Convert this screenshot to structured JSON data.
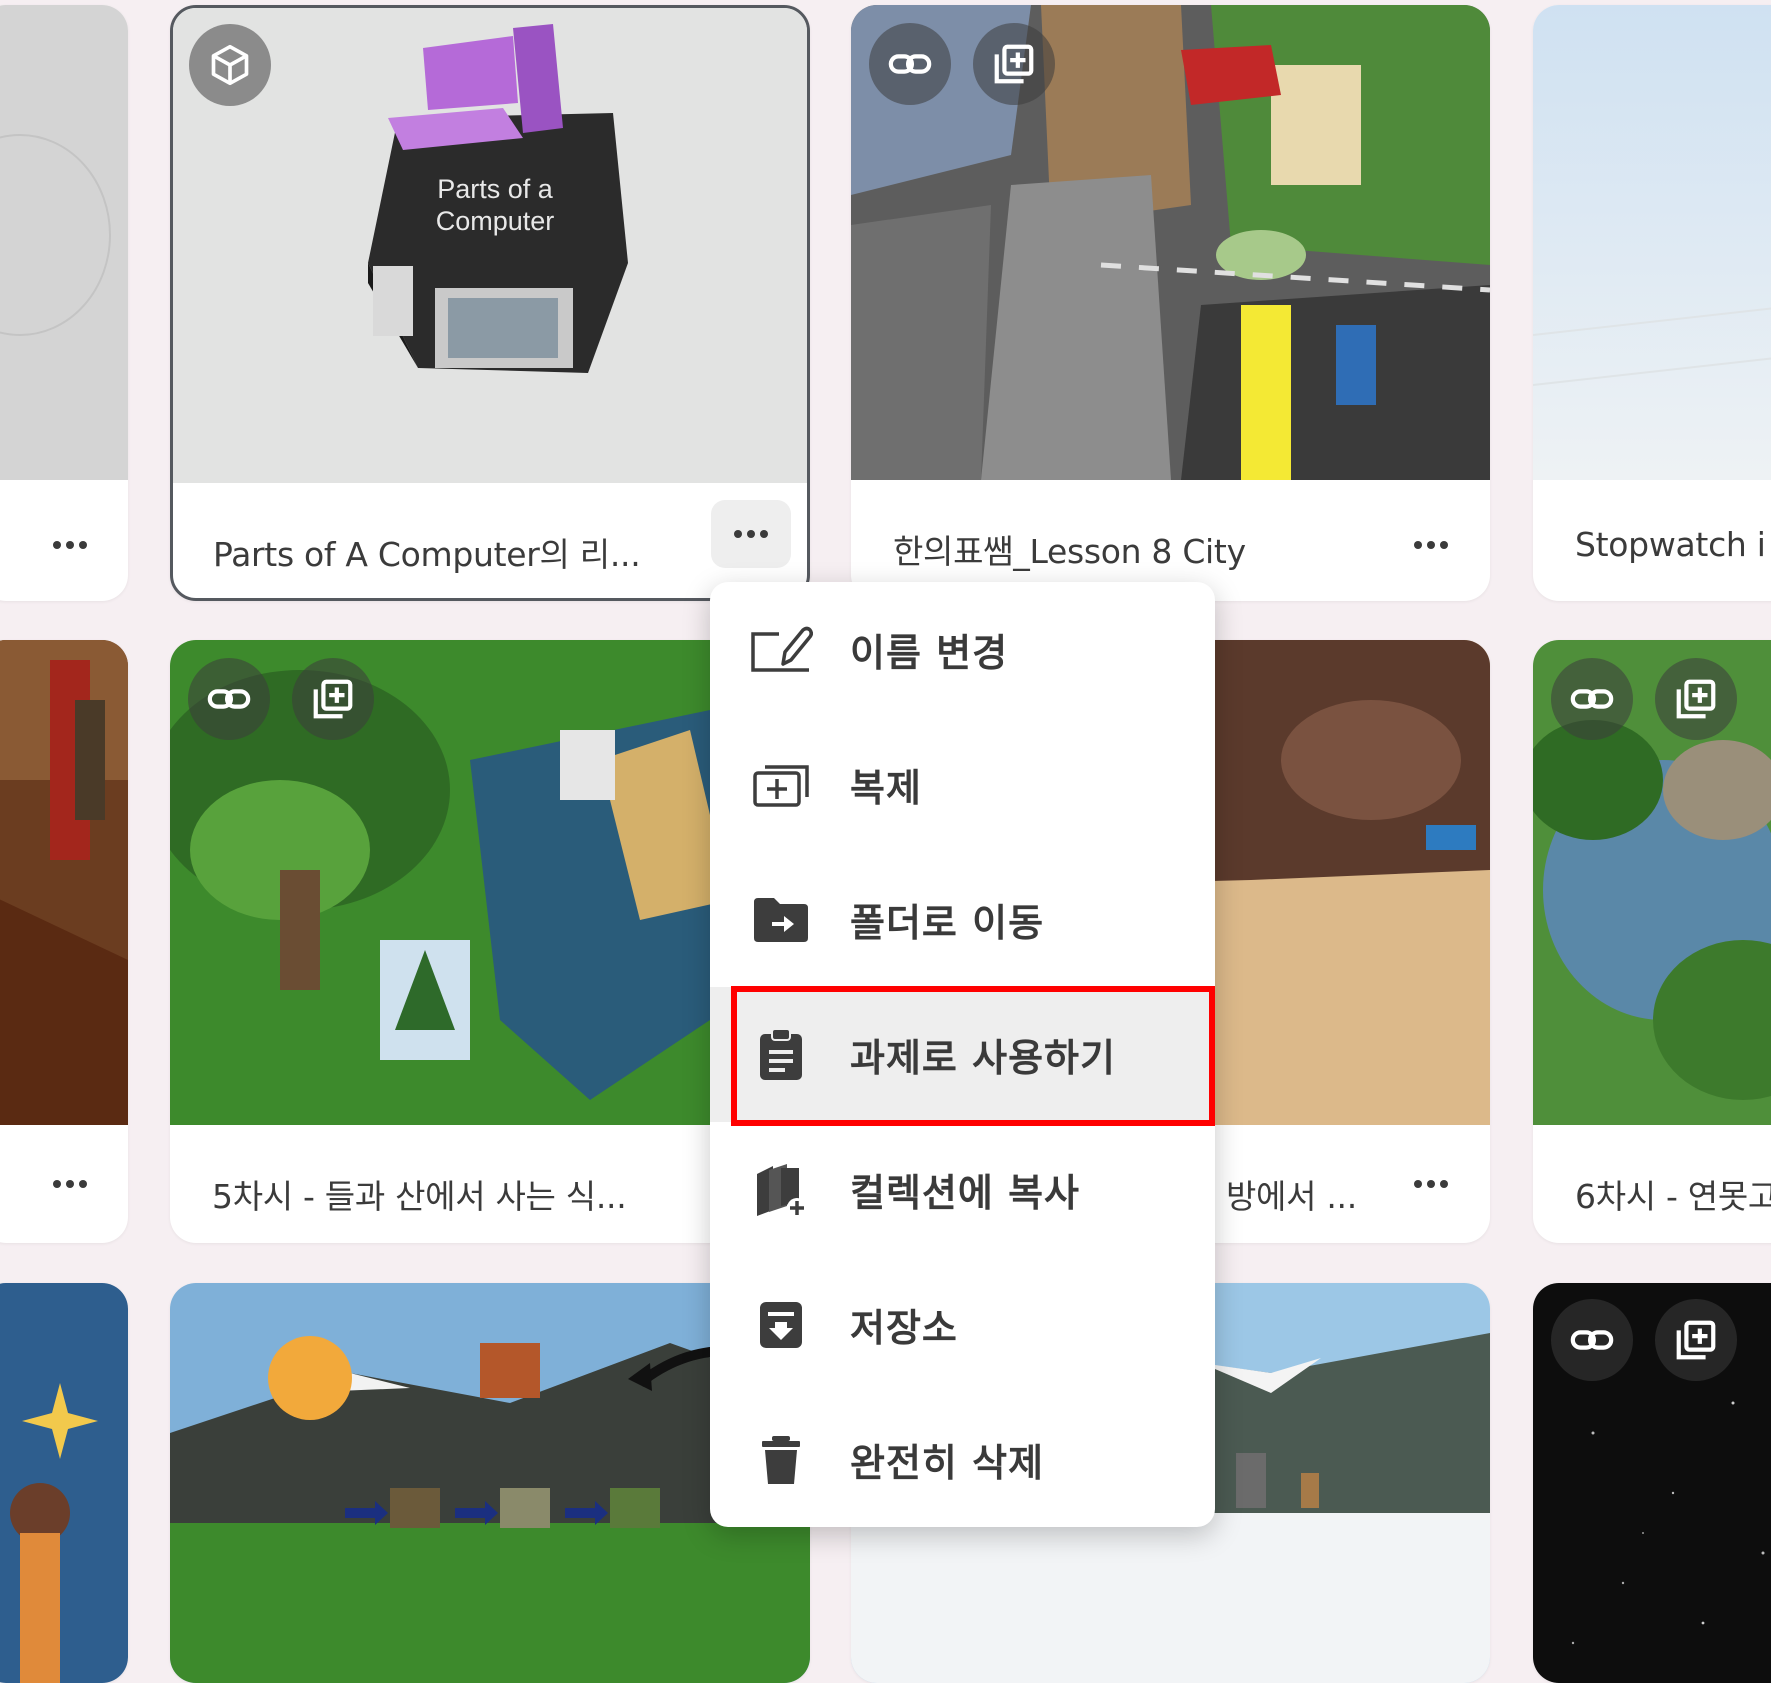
{
  "cards": {
    "r1c1": {
      "more_label": "•••"
    },
    "r1c2": {
      "title": "Parts of A Computer의 리...",
      "thumb_title_line1": "Parts of a",
      "thumb_title_line2": "Computer",
      "more_label": "•••"
    },
    "r1c3": {
      "title": "한의표쌤_Lesson 8 City",
      "more_label": "•••"
    },
    "r1c4": {
      "title": "Stopwatch i"
    },
    "r2c1": {
      "more_label": "•••"
    },
    "r2c2": {
      "title": "5차시 - 들과 산에서 사는 식..."
    },
    "r2c3": {
      "title": "방에서 ...",
      "more_label": "•••"
    },
    "r2c4": {
      "title": "6차시 - 연못고"
    }
  },
  "context_menu": {
    "items": [
      {
        "label": "이름 변경",
        "icon": "rename-icon"
      },
      {
        "label": "복제",
        "icon": "duplicate-icon"
      },
      {
        "label": "폴더로 이동",
        "icon": "move-folder-icon"
      },
      {
        "label": "과제로 사용하기",
        "icon": "assignment-clipboard-icon"
      },
      {
        "label": "컬렉션에 복사",
        "icon": "copy-to-collection-icon"
      },
      {
        "label": "저장소",
        "icon": "archive-icon"
      },
      {
        "label": "완전히 삭제",
        "icon": "trash-icon"
      }
    ],
    "highlighted_index": 3
  },
  "colors": {
    "page_bg": "#f6eff2",
    "card_bg": "#ffffff",
    "highlight_border": "#ff0000",
    "selected_border": "#55595f"
  }
}
